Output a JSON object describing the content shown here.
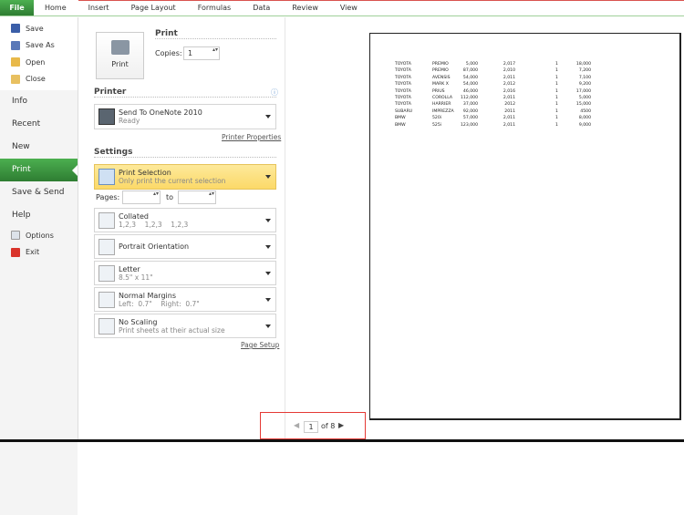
{
  "ribbon": {
    "tabs": [
      "File",
      "Home",
      "Insert",
      "Page Layout",
      "Formulas",
      "Data",
      "Review",
      "View"
    ]
  },
  "nav": {
    "small_top": [
      "Save",
      "Save As",
      "Open",
      "Close"
    ],
    "big": [
      "Info",
      "Recent",
      "New",
      "Print",
      "Save & Send",
      "Help"
    ],
    "small_bottom": [
      "Options",
      "Exit"
    ]
  },
  "print": {
    "heading": "Print",
    "button": "Print",
    "copies_label": "Copies:",
    "copies_value": "1"
  },
  "printer": {
    "heading": "Printer",
    "name": "Send To OneNote 2010",
    "status": "Ready",
    "properties_link": "Printer Properties"
  },
  "settings": {
    "heading": "Settings",
    "selection": {
      "title": "Print Selection",
      "sub": "Only print the current selection"
    },
    "pages_label": "Pages:",
    "to_label": "to",
    "collated": {
      "title": "Collated",
      "sub": "1,2,3    1,2,3    1,2,3"
    },
    "orientation": {
      "title": "Portrait Orientation"
    },
    "paper": {
      "title": "Letter",
      "sub": "8.5\" x 11\""
    },
    "margins": {
      "title": "Normal Margins",
      "sub": "Left:  0.7\"    Right:  0.7\""
    },
    "scaling": {
      "title": "No Scaling",
      "sub": "Print sheets at their actual size"
    },
    "page_setup_link": "Page Setup"
  },
  "preview": {
    "rows": [
      [
        "TOYOTA",
        "PREMIO",
        "5,000",
        "2,017",
        "1",
        "18,000"
      ],
      [
        "TOYOTA",
        "PREMIO",
        "87,000",
        "2,010",
        "1",
        "7,200"
      ],
      [
        "TOYOTA",
        "AVENSIS",
        "54,000",
        "2,011",
        "1",
        "7,100"
      ],
      [
        "TOYOTA",
        "MARK X",
        "54,000",
        "2,012",
        "1",
        "9,200"
      ],
      [
        "TOYOTA",
        "PRIUS",
        "46,000",
        "2,016",
        "1",
        "17,000"
      ],
      [
        "TOYOTA",
        "COROLLA",
        "112,000",
        "2,011",
        "1",
        "5,000"
      ],
      [
        "TOYOTA",
        "HARRIER",
        "37,000",
        "2012",
        "1",
        "15,000"
      ],
      [
        "SUBARU",
        "IMPREZZA",
        "92,000",
        "2011",
        "1",
        "4500"
      ],
      [
        "BMW",
        "520i",
        "57,000",
        "2,011",
        "1",
        "8,000"
      ],
      [
        "BMW",
        "525i",
        "123,000",
        "2,011",
        "1",
        "9,000"
      ]
    ]
  },
  "page_nav": {
    "current": "1",
    "of_label": "of 8"
  }
}
